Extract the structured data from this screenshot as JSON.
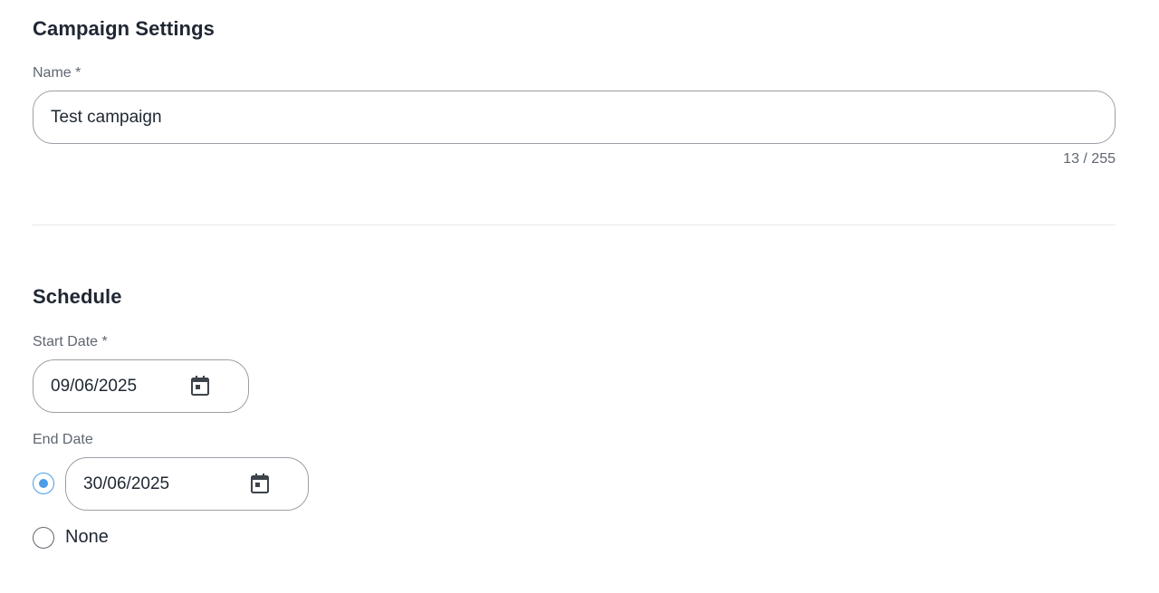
{
  "campaign_settings": {
    "title": "Campaign Settings",
    "name_label": "Name *",
    "name_value": "Test campaign",
    "char_counter": "13 / 255"
  },
  "schedule": {
    "title": "Schedule",
    "start_date_label": "Start Date *",
    "start_date_value": "09/06/2025",
    "end_date_label": "End Date",
    "end_date_value": "30/06/2025",
    "end_date_option_selected": "date",
    "none_label": "None"
  },
  "icons": {
    "calendar": "calendar-icon"
  },
  "colors": {
    "accent": "#4a9be8",
    "border": "#9aa0a6",
    "label": "#5f6670",
    "text": "#1f2733"
  }
}
